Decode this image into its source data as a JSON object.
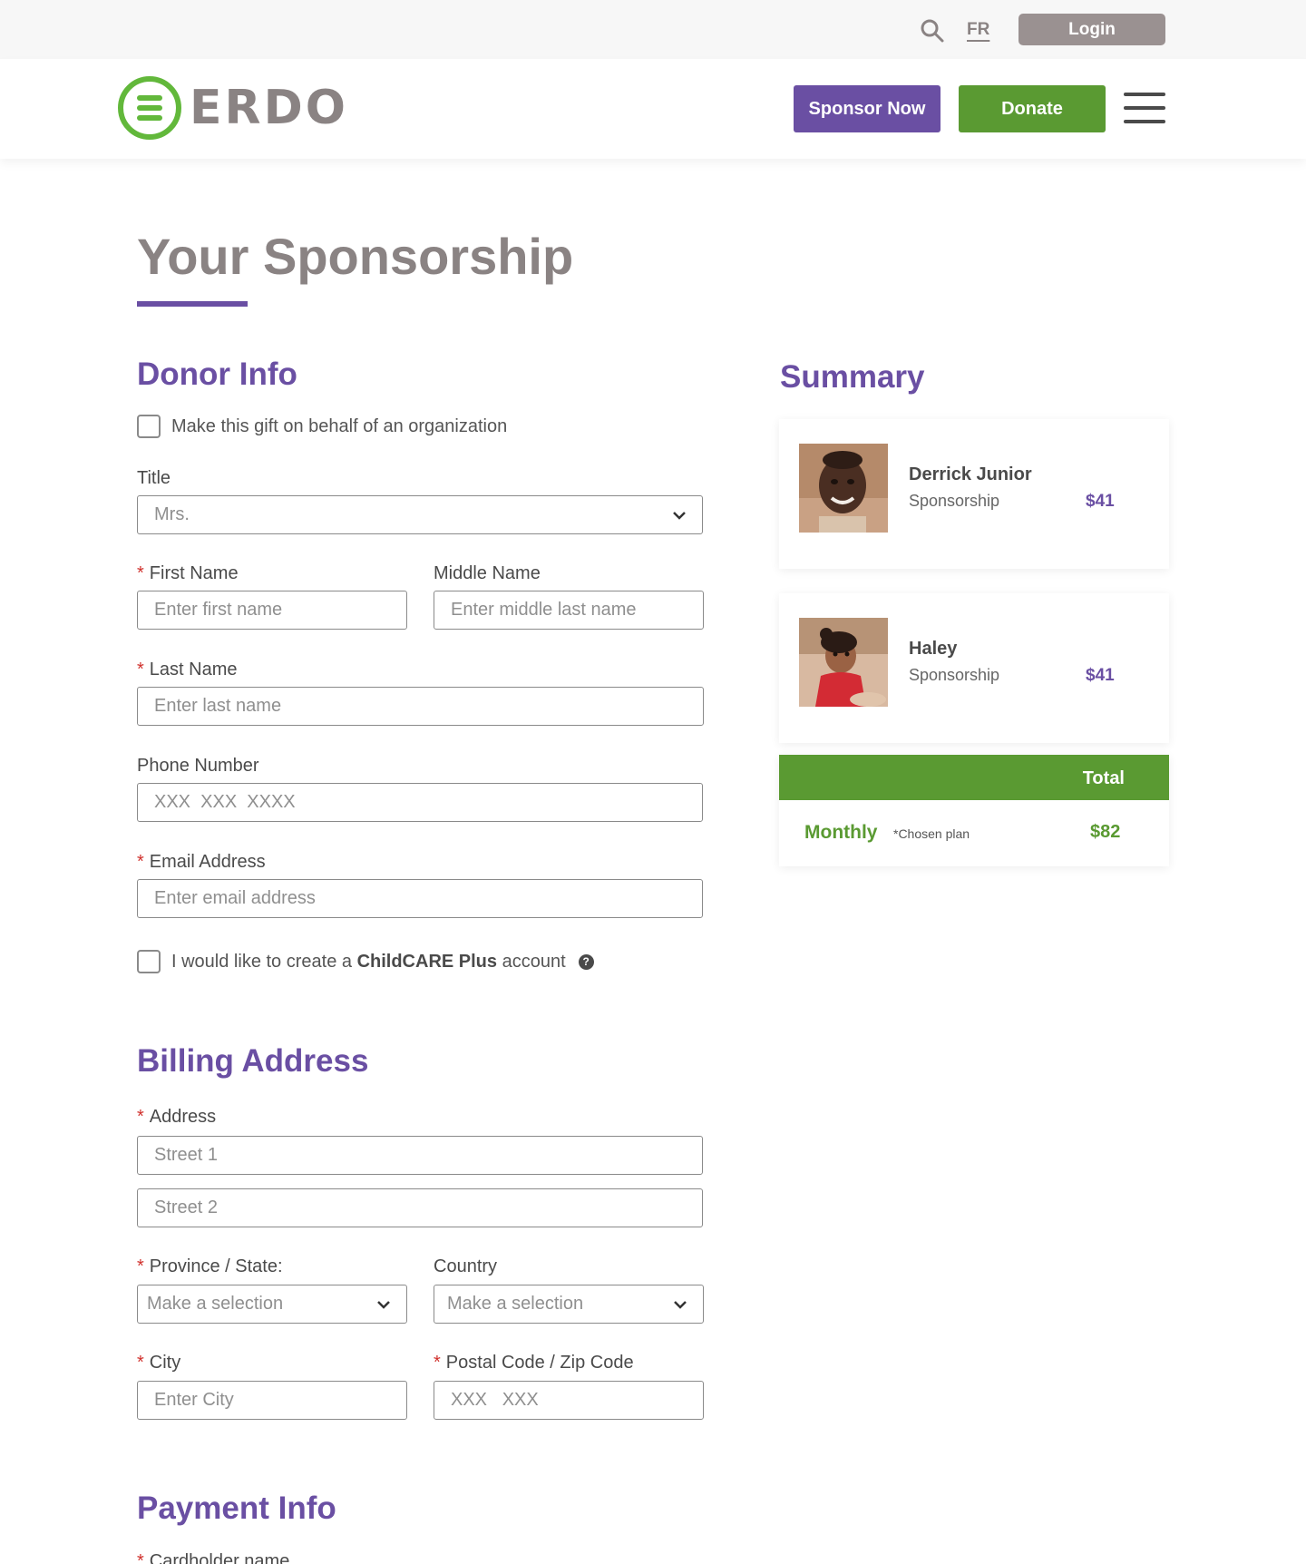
{
  "topbar": {
    "search_icon": "search-icon",
    "language": "FR",
    "login": "Login"
  },
  "header": {
    "logo_text": "ERDO",
    "sponsor_now": "Sponsor Now",
    "donate": "Donate",
    "menu_icon": "hamburger-menu-icon"
  },
  "page": {
    "title": "Your Sponsorship"
  },
  "donor_info": {
    "heading": "Donor Info",
    "org_checkbox_label": "Make this gift on behalf of an organization",
    "title_label": "Title",
    "title_value": "Mrs.",
    "first_name_label": "First Name",
    "first_name_placeholder": "Enter first name",
    "middle_name_label": "Middle Name",
    "middle_name_placeholder": "Enter middle last name",
    "last_name_label": "Last Name",
    "last_name_placeholder": "Enter last name",
    "phone_label": "Phone Number",
    "phone_placeholder": "XXX  XXX  XXXX",
    "email_label": "Email Address",
    "email_placeholder": "Enter email address",
    "account_checkbox_prefix": "I would like to create a ",
    "account_checkbox_brand": "ChildCARE Plus",
    "account_checkbox_suffix": " account",
    "help_icon": "?"
  },
  "billing": {
    "heading": "Billing Address",
    "address_label": "Address",
    "street1_placeholder": "Street 1",
    "street2_placeholder": "Street 2",
    "province_label": "Province / State:",
    "province_value": "Make a selection",
    "country_label": "Country",
    "country_value": "Make a selection",
    "city_label": "City",
    "city_placeholder": "Enter City",
    "postal_label": "Postal Code / Zip Code",
    "postal_placeholder": "XXX   XXX"
  },
  "payment": {
    "heading": "Payment Info",
    "cardholder_label": "Cardholder name"
  },
  "summary": {
    "heading": "Summary",
    "items": [
      {
        "name": "Derrick Junior",
        "plan": "Sponsorship",
        "amount": "$41"
      },
      {
        "name": "Haley",
        "plan": "Sponsorship",
        "amount": "$41"
      }
    ],
    "total_label": "Total",
    "frequency": "Monthly",
    "frequency_note": "*Chosen plan",
    "total_amount": "$82"
  },
  "colors": {
    "purple": "#6a4fa3",
    "green": "#5a9a32",
    "gray": "#8a8383",
    "required": "#d0312d"
  }
}
